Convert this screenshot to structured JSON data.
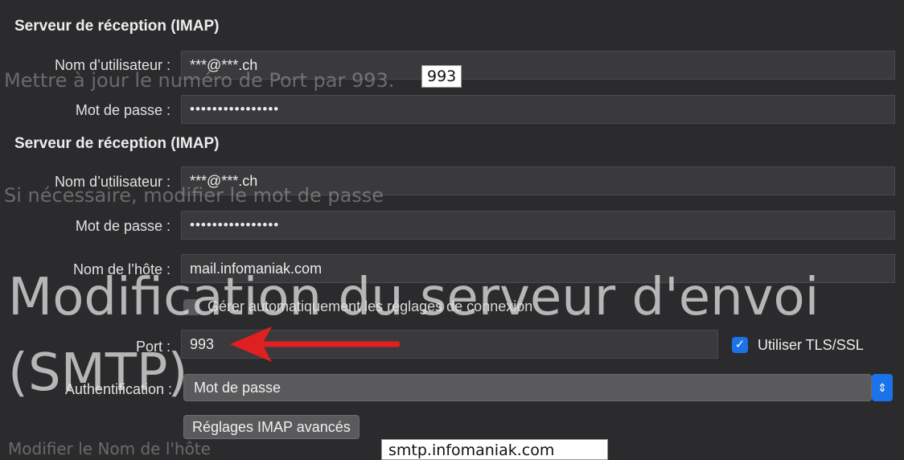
{
  "section1": {
    "heading": "Serveur de réception (IMAP)",
    "username_label": "Nom d’utilisateur :",
    "username_value": "***@***.ch",
    "password_label": "Mot de passe :",
    "password_value": "••••••••••••••••"
  },
  "tooltip_top": "993",
  "ghost_text_1": "Mettre à jour le numéro de Port par 993.",
  "section2": {
    "heading": "Serveur de réception (IMAP)",
    "username_label": "Nom d’utilisateur :",
    "username_value": "***@***.ch",
    "password_label": "Mot de passe :",
    "password_value": "••••••••••••••••",
    "host_label": "Nom de l’hôte :",
    "host_value": "mail.infomaniak.com",
    "auto_manage_label": "Gérer automatiquement les réglages de connexion",
    "port_label": "Port :",
    "port_value": "993",
    "tls_label": "Utiliser TLS/SSL",
    "auth_label": "Authentification :",
    "auth_value": "Mot de passe",
    "advanced_button": "Réglages IMAP avancés"
  },
  "ghost_text_2": "Si nécessaire, modifier le mot de passe",
  "overlay_title_line1": "Modification du serveur d'envoi",
  "overlay_title_line2": "(SMTP)",
  "ghost_text_3": "Modifier le Nom de l'hôte",
  "bottom_box_text": "smtp.infomaniak.com",
  "colors": {
    "accent": "#1a73e8",
    "arrow": "#e02020",
    "background": "#2b2b2d"
  },
  "icons": {
    "check": "checkmark-icon",
    "stepper": "up-down-chevron-icon"
  }
}
